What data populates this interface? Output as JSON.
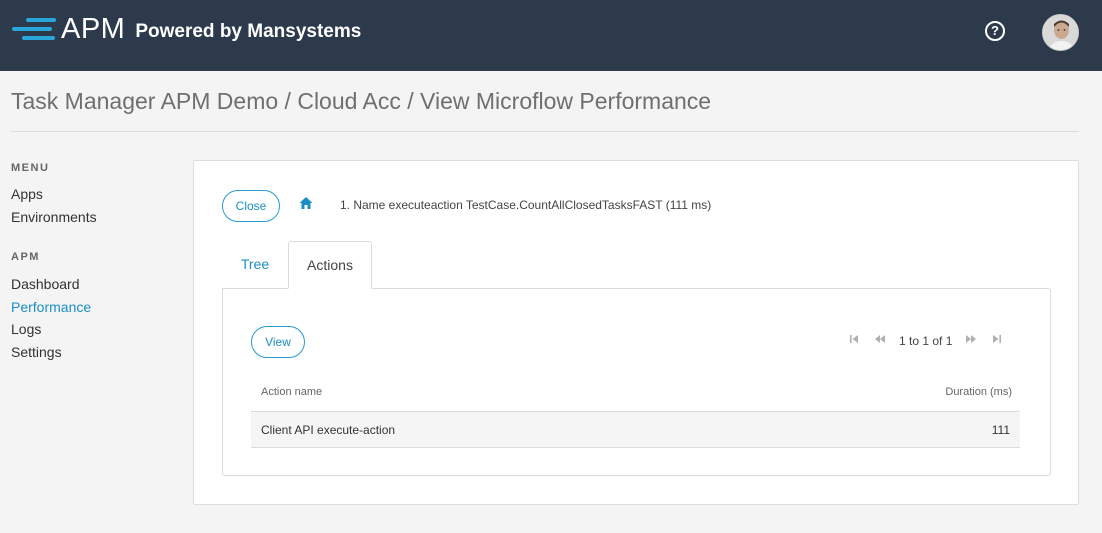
{
  "header": {
    "logo_apm": "APM",
    "logo_powered": "Powered by Mansystems",
    "help_icon": "?"
  },
  "page": {
    "title": "Task Manager APM Demo / Cloud Acc / View Microflow Performance"
  },
  "sidebar": {
    "menu_heading": "MENU",
    "menu_items": [
      {
        "label": "Apps"
      },
      {
        "label": "Environments"
      }
    ],
    "apm_heading": "APM",
    "apm_items": [
      {
        "label": "Dashboard"
      },
      {
        "label": "Performance",
        "active": true
      },
      {
        "label": "Logs"
      },
      {
        "label": "Settings"
      }
    ]
  },
  "card": {
    "close_label": "Close",
    "home_icon": "home-icon",
    "breadcrumb": "1. Name executeaction TestCase.CountAllClosedTasksFAST (111 ms)",
    "tabs": [
      {
        "label": "Tree"
      },
      {
        "label": "Actions",
        "selected": true
      }
    ],
    "view_label": "View",
    "pager": {
      "text": "1 to 1 of 1"
    },
    "table": {
      "columns": [
        "Action name",
        "Duration (ms)"
      ],
      "rows": [
        {
          "action_name": "Client API execute-action",
          "duration": "111"
        }
      ]
    }
  },
  "colors": {
    "topbar": "#2c3a4c",
    "accent": "#1a8fc6",
    "logo_bars": "#2aa7da"
  }
}
